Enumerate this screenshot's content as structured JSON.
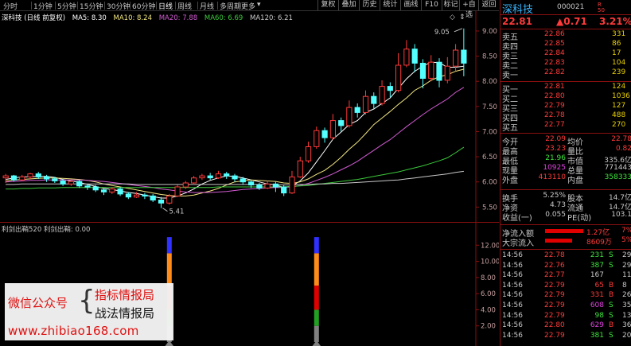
{
  "toolbar": {
    "periods": [
      "分时",
      "1分钟",
      "5分钟",
      "15分钟",
      "30分钟",
      "60分钟",
      "日线",
      "周线",
      "月线",
      "多周期",
      "更多"
    ],
    "active_period": "日线",
    "more_arrow": "▾",
    "buttons": [
      "复权",
      "叠加",
      "历史",
      "统计",
      "画线",
      "F10",
      "标记",
      "+自选",
      "返回"
    ]
  },
  "kline": {
    "stock_label": "深科技 (日线 前复权)",
    "ma": [
      {
        "label": "MA5: 8.30",
        "color": "#ffffff"
      },
      {
        "label": "MA10: 8.24",
        "color": "#f2e680"
      },
      {
        "label": "MA20: 7.88",
        "color": "#d25ad2"
      },
      {
        "label": "MA60: 6.69",
        "color": "#3cc83c"
      },
      {
        "label": "MA120: 6.21",
        "color": "#c8c8c8"
      }
    ],
    "high_label": "9.05",
    "low_label": "5.41",
    "corner_icons": [
      "◇",
      "⇕"
    ]
  },
  "indicator": {
    "legend": "利剑出鞘520  利剑出鞘: 0.00"
  },
  "watermark": {
    "left": "微信公众号",
    "right1": "指标情报局",
    "right2": "战法情报局",
    "url": "www.zhibiao168.com"
  },
  "info": {
    "title": "深科技",
    "code": "000021",
    "badge": "R",
    "badge2": "50",
    "price": "22.81",
    "change": "▲0.71",
    "pct": "3.21%",
    "sells": [
      {
        "label": "卖五",
        "price": "22.86",
        "vol": "331"
      },
      {
        "label": "卖四",
        "price": "22.85",
        "vol": "86"
      },
      {
        "label": "卖三",
        "price": "22.84",
        "vol": "17"
      },
      {
        "label": "卖二",
        "price": "22.83",
        "vol": "104"
      },
      {
        "label": "卖一",
        "price": "22.82",
        "vol": "239"
      }
    ],
    "buys": [
      {
        "label": "买一",
        "price": "22.81",
        "vol": "124"
      },
      {
        "label": "买二",
        "price": "22.80",
        "vol": "1036"
      },
      {
        "label": "买三",
        "price": "22.79",
        "vol": "127"
      },
      {
        "label": "买四",
        "price": "22.78",
        "vol": "488"
      },
      {
        "label": "买五",
        "price": "22.77",
        "vol": "270"
      }
    ],
    "stats": [
      {
        "l1": "今开",
        "v1": "22.09",
        "c1": "#ff3a3a",
        "l2": "均价",
        "v2": "22.78",
        "c2": "#ff3a3a"
      },
      {
        "l1": "最高",
        "v1": "23.23",
        "c1": "#ff3a3a",
        "l2": "量比",
        "v2": "0.82",
        "c2": "#ff3a3a"
      },
      {
        "l1": "最低",
        "v1": "21.96",
        "c1": "#3ce63c",
        "l2": "市值",
        "v2": "335.6亿",
        "c2": "#c8c8c8"
      },
      {
        "l1": "现量",
        "v1": "10925",
        "c1": "#e040e0",
        "l2": "总量",
        "v2": "771443",
        "c2": "#c8c8c8"
      },
      {
        "l1": "外盘",
        "v1": "413110",
        "c1": "#ff3a3a",
        "l2": "内盘",
        "v2": "358333",
        "c2": "#3ce63c"
      }
    ],
    "stats2": [
      {
        "l1": "换手",
        "v1": "5.25%",
        "c1": "#c8c8c8",
        "l2": "股本",
        "v2": "14.7亿",
        "c2": "#c8c8c8"
      },
      {
        "l1": "净资",
        "v1": "4.73",
        "c1": "#c8c8c8",
        "l2": "流通",
        "v2": "14.7亿",
        "c2": "#c8c8c8"
      },
      {
        "l1": "收益(一)",
        "v1": "0.055",
        "c1": "#c8c8c8",
        "l2": "PE(动)",
        "v2": "103.1",
        "c2": "#c8c8c8"
      }
    ],
    "flows": [
      {
        "label": "净流入额",
        "bar": 0.6,
        "value": "1.27亿",
        "pct": "7%"
      },
      {
        "label": "大宗流入",
        "bar": 0.42,
        "value": "8609万",
        "pct": "5%"
      }
    ],
    "ticks": [
      {
        "time": "14:56",
        "price": "22.78",
        "vol": "231",
        "side": "S",
        "count": "29"
      },
      {
        "time": "14:56",
        "price": "22.76",
        "vol": "387",
        "side": "S",
        "count": "29"
      },
      {
        "time": "14:56",
        "price": "22.77",
        "vol": "167",
        "side": "",
        "count": "11"
      },
      {
        "time": "14:56",
        "price": "22.79",
        "vol": "65",
        "side": "B",
        "count": "8"
      },
      {
        "time": "14:56",
        "price": "22.79",
        "vol": "331",
        "side": "B",
        "count": "26"
      },
      {
        "time": "14:56",
        "price": "22.79",
        "vol": "608",
        "side": "S",
        "count": "35"
      },
      {
        "time": "14:56",
        "price": "22.79",
        "vol": "98",
        "side": "S",
        "count": "13"
      },
      {
        "time": "14:56",
        "price": "22.80",
        "vol": "629",
        "side": "B",
        "count": "36"
      },
      {
        "time": "14:56",
        "price": "22.79",
        "vol": "381",
        "side": "S",
        "count": "20"
      }
    ]
  },
  "chart_data": [
    {
      "type": "candlestick",
      "title": "",
      "y_ticks": [
        5.5,
        6.0,
        6.5,
        7.0,
        7.5,
        8.0,
        8.5,
        9.0
      ],
      "ylim": [
        5.3,
        9.3
      ],
      "up_color": "#ff3a3a",
      "down_color": "#54ffff",
      "candles": [
        [
          6.08,
          6.12,
          6.16,
          5.98
        ],
        [
          6.12,
          6.04,
          6.14,
          6.01
        ],
        [
          6.04,
          6.1,
          6.14,
          6.02
        ],
        [
          6.1,
          6.16,
          6.18,
          6.06
        ],
        [
          6.16,
          6.1,
          6.2,
          6.06
        ],
        [
          6.1,
          6.06,
          6.14,
          6.0
        ],
        [
          6.06,
          6.02,
          6.1,
          5.98
        ],
        [
          6.02,
          5.96,
          6.06,
          5.92
        ],
        [
          5.96,
          6.01,
          6.05,
          5.92
        ],
        [
          6.01,
          5.92,
          6.04,
          5.88
        ],
        [
          5.92,
          5.9,
          5.96,
          5.84
        ],
        [
          5.9,
          5.84,
          5.94,
          5.8
        ],
        [
          5.84,
          5.8,
          5.88,
          5.74
        ],
        [
          5.8,
          5.86,
          5.9,
          5.76
        ],
        [
          5.86,
          5.76,
          5.9,
          5.72
        ],
        [
          5.76,
          5.7,
          5.8,
          5.66
        ],
        [
          5.7,
          5.74,
          5.8,
          5.68
        ],
        [
          5.74,
          5.72,
          5.78,
          5.66
        ],
        [
          5.72,
          5.64,
          5.76,
          5.6
        ],
        [
          5.64,
          5.58,
          5.7,
          5.48
        ],
        [
          5.58,
          5.72,
          5.76,
          5.55
        ],
        [
          5.72,
          5.9,
          5.94,
          5.7
        ],
        [
          5.9,
          5.98,
          6.02,
          5.86
        ],
        [
          5.98,
          6.08,
          6.12,
          5.94
        ],
        [
          6.08,
          6.12,
          6.16,
          6.04
        ],
        [
          6.12,
          6.08,
          6.18,
          6.04
        ],
        [
          6.08,
          6.16,
          6.22,
          6.06
        ],
        [
          6.16,
          6.12,
          6.2,
          6.06
        ],
        [
          6.12,
          6.06,
          6.16,
          6.0
        ],
        [
          6.06,
          6.0,
          6.1,
          5.94
        ],
        [
          6.0,
          5.94,
          6.04,
          5.88
        ],
        [
          5.94,
          5.88,
          5.98,
          5.84
        ],
        [
          5.88,
          5.96,
          6.02,
          5.86
        ],
        [
          5.96,
          5.9,
          6.0,
          5.8
        ],
        [
          5.9,
          5.78,
          5.94,
          5.72
        ],
        [
          5.78,
          6.1,
          6.22,
          5.76
        ],
        [
          6.1,
          6.42,
          6.5,
          6.08
        ],
        [
          6.42,
          6.7,
          6.8,
          6.38
        ],
        [
          6.7,
          7.02,
          7.1,
          6.66
        ],
        [
          7.02,
          6.88,
          7.08,
          6.78
        ],
        [
          6.88,
          7.22,
          7.35,
          6.84
        ],
        [
          7.22,
          7.12,
          7.28,
          7.0
        ],
        [
          7.12,
          7.48,
          7.62,
          7.08
        ],
        [
          7.48,
          7.38,
          7.56,
          7.28
        ],
        [
          7.38,
          7.7,
          7.82,
          7.34
        ],
        [
          7.7,
          7.56,
          7.78,
          7.46
        ],
        [
          7.56,
          7.9,
          8.02,
          7.52
        ],
        [
          7.9,
          7.82,
          7.98,
          7.68
        ],
        [
          7.82,
          8.32,
          8.56,
          7.78
        ],
        [
          8.32,
          8.64,
          8.82,
          8.28
        ],
        [
          8.64,
          8.36,
          8.74,
          8.18
        ],
        [
          8.36,
          8.06,
          8.44,
          7.86
        ],
        [
          8.06,
          8.38,
          8.52,
          8.0
        ],
        [
          8.38,
          8.02,
          8.46,
          7.88
        ],
        [
          8.02,
          8.3,
          8.48,
          7.96
        ],
        [
          8.3,
          8.62,
          8.74,
          8.2
        ],
        [
          8.62,
          8.36,
          9.05,
          8.1
        ]
      ],
      "series": [
        {
          "name": "MA5",
          "color": "#ffffff",
          "values": [
            6.05,
            6.08,
            6.1,
            6.1,
            6.11,
            6.11,
            6.09,
            6.05,
            6.02,
            5.99,
            5.95,
            5.91,
            5.87,
            5.85,
            5.82,
            5.79,
            5.77,
            5.74,
            5.71,
            5.68,
            5.68,
            5.72,
            5.78,
            5.86,
            5.96,
            6.03,
            6.08,
            6.12,
            6.11,
            6.08,
            6.04,
            6.0,
            5.96,
            5.94,
            5.89,
            5.92,
            6.02,
            6.18,
            6.4,
            6.62,
            6.85,
            6.99,
            7.14,
            7.22,
            7.38,
            7.45,
            7.56,
            7.67,
            7.86,
            8.05,
            8.2,
            8.3,
            8.38,
            8.37,
            8.28,
            8.28,
            8.3
          ]
        },
        {
          "name": "MA10",
          "color": "#f2e680",
          "values": [
            6.02,
            6.04,
            6.05,
            6.06,
            6.07,
            6.08,
            6.08,
            6.07,
            6.06,
            6.05,
            6.03,
            6.0,
            5.96,
            5.93,
            5.9,
            5.87,
            5.84,
            5.81,
            5.78,
            5.75,
            5.73,
            5.72,
            5.72,
            5.74,
            5.78,
            5.82,
            5.87,
            5.94,
            6.0,
            6.02,
            6.04,
            6.03,
            6.02,
            6.01,
            5.98,
            5.97,
            6.0,
            6.06,
            6.15,
            6.23,
            6.35,
            6.49,
            6.65,
            6.79,
            6.96,
            7.14,
            7.27,
            7.4,
            7.54,
            7.67,
            7.82,
            7.91,
            8.02,
            8.09,
            8.13,
            8.2,
            8.24
          ]
        },
        {
          "name": "MA20",
          "color": "#d25ad2",
          "values": [
            6.0,
            6.01,
            6.02,
            6.03,
            6.03,
            6.04,
            6.04,
            6.04,
            6.04,
            6.04,
            6.03,
            6.02,
            6.01,
            5.99,
            5.97,
            5.95,
            5.93,
            5.91,
            5.89,
            5.86,
            5.84,
            5.82,
            5.8,
            5.79,
            5.79,
            5.79,
            5.8,
            5.81,
            5.83,
            5.85,
            5.86,
            5.87,
            5.88,
            5.89,
            5.89,
            5.9,
            5.93,
            5.97,
            6.03,
            6.09,
            6.16,
            6.24,
            6.32,
            6.41,
            6.52,
            6.63,
            6.74,
            6.84,
            6.97,
            7.1,
            7.22,
            7.34,
            7.45,
            7.55,
            7.65,
            7.78,
            7.88
          ]
        },
        {
          "name": "MA60",
          "color": "#3cc83c",
          "values": [
            5.86,
            5.86,
            5.87,
            5.87,
            5.88,
            5.88,
            5.88,
            5.89,
            5.89,
            5.89,
            5.89,
            5.89,
            5.89,
            5.89,
            5.89,
            5.89,
            5.89,
            5.89,
            5.89,
            5.89,
            5.89,
            5.89,
            5.89,
            5.89,
            5.89,
            5.89,
            5.9,
            5.9,
            5.9,
            5.9,
            5.9,
            5.9,
            5.9,
            5.9,
            5.9,
            5.91,
            5.92,
            5.93,
            5.95,
            5.97,
            5.99,
            6.01,
            6.03,
            6.05,
            6.08,
            6.11,
            6.14,
            6.17,
            6.2,
            6.24,
            6.28,
            6.32,
            6.37,
            6.42,
            6.48,
            6.58,
            6.69
          ]
        },
        {
          "name": "MA120",
          "color": "#c8c8c8",
          "values": [
            5.95,
            5.95,
            5.96,
            5.96,
            5.96,
            5.96,
            5.96,
            5.96,
            5.96,
            5.96,
            5.96,
            5.96,
            5.96,
            5.96,
            5.96,
            5.96,
            5.95,
            5.95,
            5.95,
            5.95,
            5.95,
            5.95,
            5.95,
            5.95,
            5.95,
            5.95,
            5.95,
            5.95,
            5.95,
            5.95,
            5.95,
            5.95,
            5.95,
            5.95,
            5.94,
            5.94,
            5.95,
            5.95,
            5.96,
            5.96,
            5.97,
            5.97,
            5.98,
            5.99,
            6.0,
            6.01,
            6.02,
            6.03,
            6.04,
            6.06,
            6.08,
            6.1,
            6.12,
            6.14,
            6.16,
            6.19,
            6.21
          ]
        }
      ]
    },
    {
      "type": "bar",
      "title": "",
      "y_ticks": [
        2.0,
        4.0,
        6.0,
        8.0,
        10.0,
        12.0
      ],
      "ylim": [
        0,
        14
      ],
      "bars": [
        {
          "index": 20,
          "segments": [
            {
              "to": 2,
              "color": "#808080"
            },
            {
              "to": 4,
              "color": "#22a022"
            },
            {
              "to": 7,
              "color": "#e00000"
            },
            {
              "to": 11,
              "color": "#ff8c1a"
            },
            {
              "to": 13,
              "color": "#3030ff"
            }
          ]
        },
        {
          "index": 38,
          "segments": [
            {
              "to": 2,
              "color": "#808080"
            },
            {
              "to": 4,
              "color": "#22a022"
            },
            {
              "to": 7,
              "color": "#e00000"
            },
            {
              "to": 11,
              "color": "#ff8c1a"
            },
            {
              "to": 13,
              "color": "#3030ff"
            }
          ]
        }
      ]
    }
  ]
}
